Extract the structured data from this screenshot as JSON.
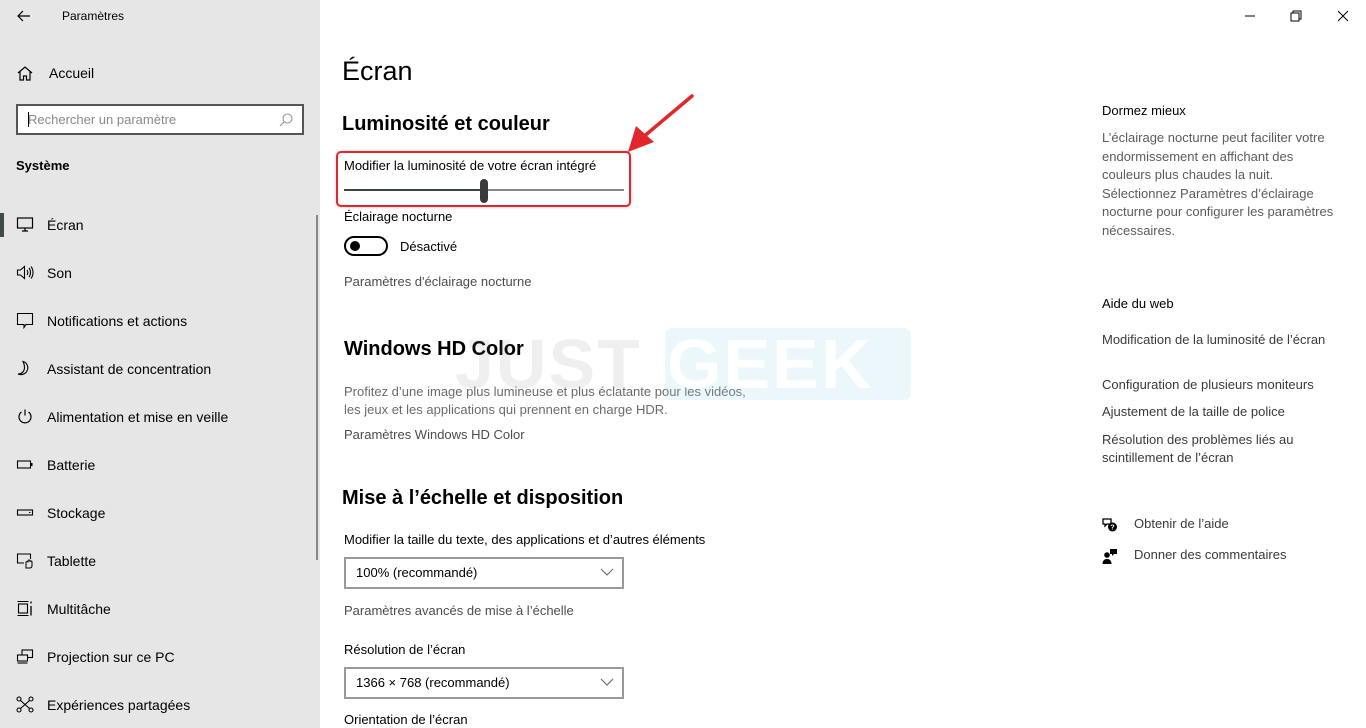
{
  "window": {
    "app_title": "Paramètres",
    "controls": [
      "minimize",
      "restore",
      "close"
    ]
  },
  "sidebar": {
    "home_label": "Accueil",
    "search_placeholder": "Rechercher un paramètre",
    "search_value": "",
    "section_title": "Système",
    "items": [
      {
        "label": "Écran",
        "icon": "monitor-icon",
        "selected": true
      },
      {
        "label": "Son",
        "icon": "speaker-icon",
        "selected": false
      },
      {
        "label": "Notifications et actions",
        "icon": "notification-icon",
        "selected": false
      },
      {
        "label": "Assistant de concentration",
        "icon": "moon-icon",
        "selected": false
      },
      {
        "label": "Alimentation et mise en veille",
        "icon": "power-icon",
        "selected": false
      },
      {
        "label": "Batterie",
        "icon": "battery-icon",
        "selected": false
      },
      {
        "label": "Stockage",
        "icon": "storage-icon",
        "selected": false
      },
      {
        "label": "Tablette",
        "icon": "tablet-icon",
        "selected": false
      },
      {
        "label": "Multitâche",
        "icon": "multitask-icon",
        "selected": false
      },
      {
        "label": "Projection sur ce PC",
        "icon": "projection-icon",
        "selected": false
      },
      {
        "label": "Expériences partagées",
        "icon": "shared-experiences-icon",
        "selected": false
      }
    ]
  },
  "main": {
    "page_title": "Écran",
    "brightness_section": {
      "heading": "Luminosité et couleur",
      "slider_label": "Modifier la luminosité de votre écran intégré",
      "brightness_percent": 50
    },
    "night_light": {
      "label": "Éclairage nocturne",
      "state_label": "Désactivé",
      "enabled": false,
      "settings_link": "Paramètres d'éclairage nocturne"
    },
    "hd_color": {
      "heading": "Windows HD Color",
      "description_line1": "Profitez d’une image plus lumineuse et plus éclatante pour les vidéos,",
      "description_line2": "les jeux et les applications qui prennent en charge HDR.",
      "settings_link": "Paramètres Windows HD Color"
    },
    "scale_layout": {
      "heading": "Mise à l’échelle et disposition",
      "scale_label": "Modifier la taille du texte, des applications et d’autres éléments",
      "scale_value": "100% (recommandé)",
      "advanced_link": "Paramètres avancés de mise à l’échelle",
      "resolution_label": "Résolution de l’écran",
      "resolution_value": "1366 × 768 (recommandé)",
      "orientation_label": "Orientation de l’écran"
    },
    "watermark": {
      "part1": "JUST",
      "part2": "GEEK"
    },
    "annotation_color": "#e3262b"
  },
  "aside": {
    "sleep_heading": "Dormez mieux",
    "sleep_text": "L’éclairage nocturne peut faciliter votre endormissement en affichant des couleurs plus chaudes la nuit. Sélectionnez Paramètres d’éclairage nocturne pour configurer les paramètres nécessaires.",
    "web_help_heading": "Aide du web",
    "web_links": [
      "Modification de la luminosité de l’écran",
      "Configuration de plusieurs moniteurs",
      "Ajustement de la taille de police",
      "Résolution des problèmes liés au scintillement de l’écran"
    ],
    "get_help": "Obtenir de l’aide",
    "feedback": "Donner des commentaires"
  }
}
